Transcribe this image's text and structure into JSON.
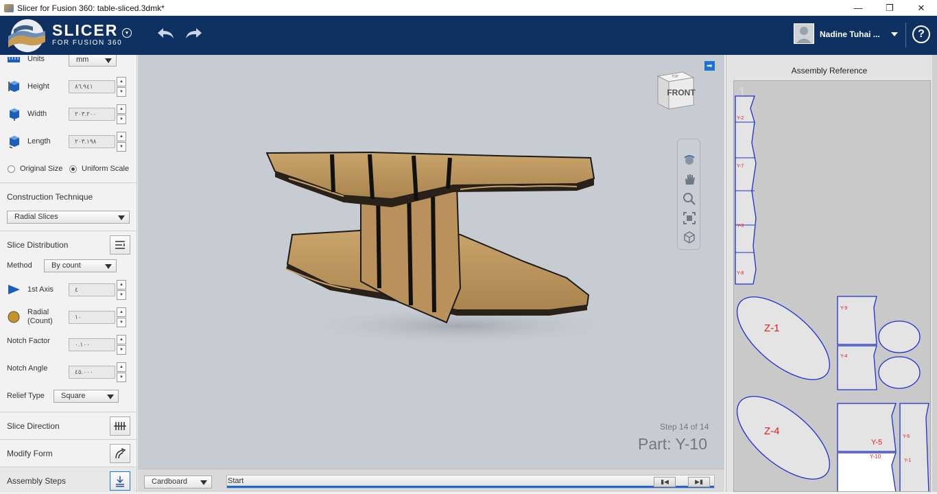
{
  "window": {
    "title": "Slicer for Fusion 360: table-sliced.3dmk*",
    "minimize": "—",
    "maximize": "❐",
    "close": "✕"
  },
  "header": {
    "logo_big": "SLICER",
    "logo_small": "FOR FUSION 360",
    "user_name": "Nadine Tuhai ...",
    "help": "?"
  },
  "object_size": {
    "units_label": "Units",
    "units_value": "mm",
    "height_label": "Height",
    "height_value": "٨٦.٩٤١",
    "width_label": "Width",
    "width_value": "٢٠٣.٢٠٠",
    "length_label": "Length",
    "length_value": "٢٠٣.١٩٨",
    "original_size_label": "Original Size",
    "uniform_scale_label": "Uniform Scale"
  },
  "construction": {
    "title": "Construction Technique",
    "value": "Radial Slices"
  },
  "slice_distribution": {
    "title": "Slice Distribution",
    "method_label": "Method",
    "method_value": "By count",
    "axis1_label": "1st Axis",
    "axis1_value": "٤",
    "radial_label_1": "Radial",
    "radial_label_2": "(Count)",
    "radial_value": "١٠",
    "notch_factor_label": "Notch Factor",
    "notch_factor_value": "٠.١٠٠",
    "notch_angle_label": "Notch Angle",
    "notch_angle_value": "٤٥.٠٠٠",
    "relief_label": "Relief Type",
    "relief_value": "Square"
  },
  "sections": {
    "slice_direction": "Slice Direction",
    "modify_form": "Modify Form",
    "assembly_steps": "Assembly Steps"
  },
  "viewport": {
    "viewcube_face": "FRONT",
    "viewcube_top": "TOP",
    "step_text": "Step 14 of 14",
    "part_text": "Part: Y-10"
  },
  "bottom": {
    "material_value": "Cardboard",
    "timeline_label": "Start",
    "timeline_progress": 1.0
  },
  "assembly_reference": {
    "title": "Assembly Reference",
    "sheet_number": "1",
    "parts": [
      "Y-2",
      "Y-7",
      "Y-3",
      "Y-8",
      "Z-1",
      "Y-9",
      "Y-4",
      "Z-4",
      "Y-5",
      "Y-6",
      "Y-10",
      "Y-1"
    ]
  },
  "colors": {
    "header_bg": "#0f3161",
    "viewport_bg": "#c7ccd2",
    "cardboard": "#b8925a",
    "part_outline": "#1b2fd0",
    "part_label": "#e21c1c",
    "accent_blue": "#1a74d3"
  }
}
